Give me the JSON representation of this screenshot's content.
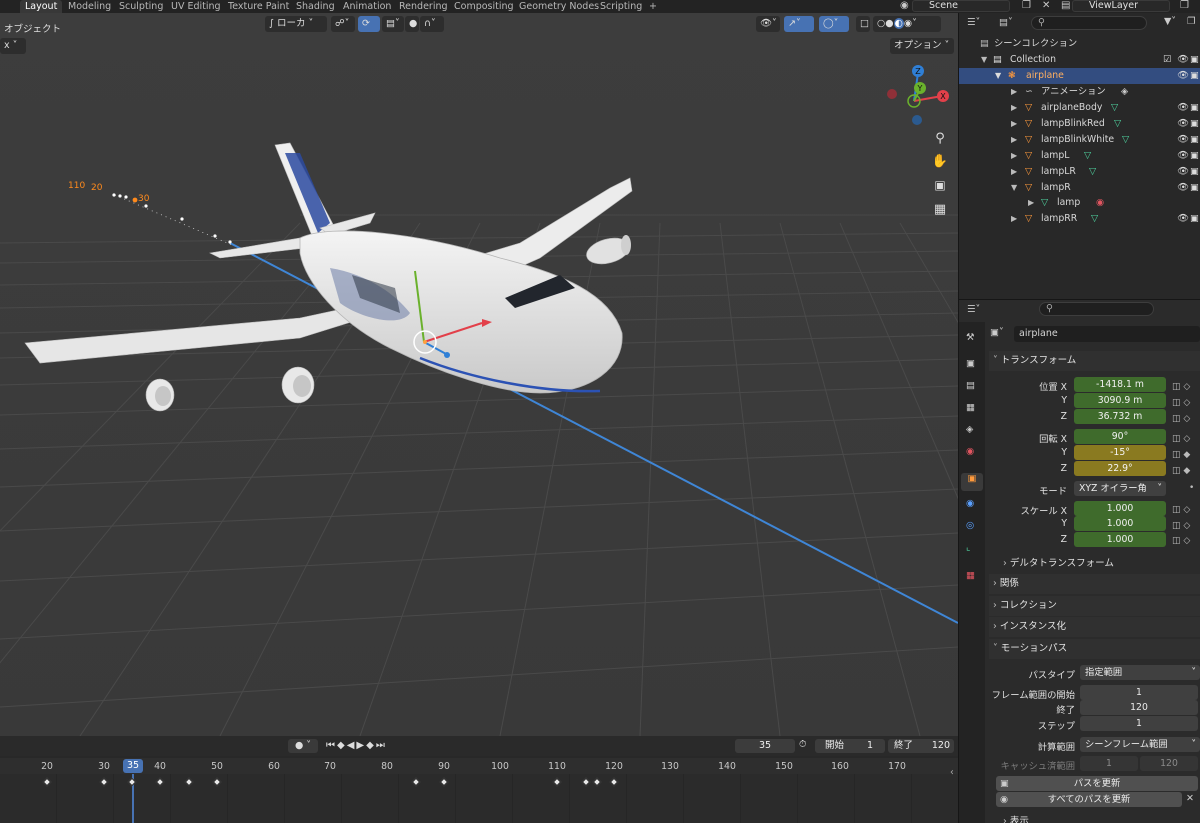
{
  "topbar": {
    "tabs": [
      "Layout",
      "Modeling",
      "Sculpting",
      "UV Editing",
      "Texture Paint",
      "Shading",
      "Animation",
      "Rendering",
      "Compositing",
      "Geometry Nodes",
      "Scripting"
    ],
    "add_tab_label": "+",
    "scene_name": "Scene",
    "view_layer_name": "ViewLayer"
  },
  "viewport": {
    "mode_label": "オブジェクト",
    "pivot_label": "x",
    "orientation_label": "ローカ",
    "options_label": "オプション",
    "motion_path_labels": [
      "110",
      "20",
      "30"
    ],
    "gizmo_axes": {
      "z": "Z",
      "y": "Y",
      "x": "X"
    },
    "colors": {
      "x_axis": "#e2404a",
      "y_axis": "#6ab12c",
      "z_axis": "#2f7fd6",
      "accent": "#4772b3"
    }
  },
  "outliner": {
    "root_label": "シーンコレクション",
    "collection_label": "Collection",
    "items": [
      {
        "label": "airplane",
        "selected": true
      },
      {
        "label": "アニメーション"
      },
      {
        "label": "airplaneBody"
      },
      {
        "label": "lampBlinkRed"
      },
      {
        "label": "lampBlinkWhite"
      },
      {
        "label": "lampL"
      },
      {
        "label": "lampLR"
      },
      {
        "label": "lampR"
      },
      {
        "label": "lamp"
      },
      {
        "label": "lampRR"
      }
    ]
  },
  "properties": {
    "object_name": "airplane",
    "transform_header": "トランスフォーム",
    "location": {
      "label_x": "位置 X",
      "label_y": "Y",
      "label_z": "Z",
      "x": "-1418.1 m",
      "y": "3090.9 m",
      "z": "36.732 m"
    },
    "rotation": {
      "label_x": "回転 X",
      "label_y": "Y",
      "label_z": "Z",
      "x": "90°",
      "y": "-15°",
      "z": "22.9°"
    },
    "mode": {
      "label": "モード",
      "value": "XYZ オイラー角"
    },
    "scale": {
      "label_x": "スケール X",
      "label_y": "Y",
      "label_z": "Z",
      "x": "1.000",
      "y": "1.000",
      "z": "1.000"
    },
    "delta_transform": "デルタトランスフォーム",
    "relations": "関係",
    "collections": "コレクション",
    "instancing": "インスタンス化",
    "motion_paths": {
      "header": "モーションパス",
      "path_type_label": "パスタイプ",
      "path_type_value": "指定範囲",
      "frame_start_label": "フレーム範囲の開始",
      "frame_start_value": "1",
      "end_label": "終了",
      "end_value": "120",
      "step_label": "ステップ",
      "step_value": "1",
      "calc_range_label": "計算範囲",
      "calc_range_value": "シーンフレーム範囲",
      "cache_range_label": "キャッシュ済範囲",
      "cache_start": "1",
      "cache_end": "120",
      "update_path_button": "パスを更新",
      "update_all_button": "すべてのパスを更新"
    },
    "display_label": "表示"
  },
  "timeline": {
    "current_frame": "35",
    "start_label": "開始",
    "start_value": "1",
    "end_label": "終了",
    "end_value": "120",
    "frame_labels": [
      "20",
      "30",
      "35",
      "40",
      "50",
      "60",
      "70",
      "80",
      "90",
      "100",
      "110",
      "120",
      "130",
      "140",
      "150",
      "160",
      "170"
    ]
  }
}
